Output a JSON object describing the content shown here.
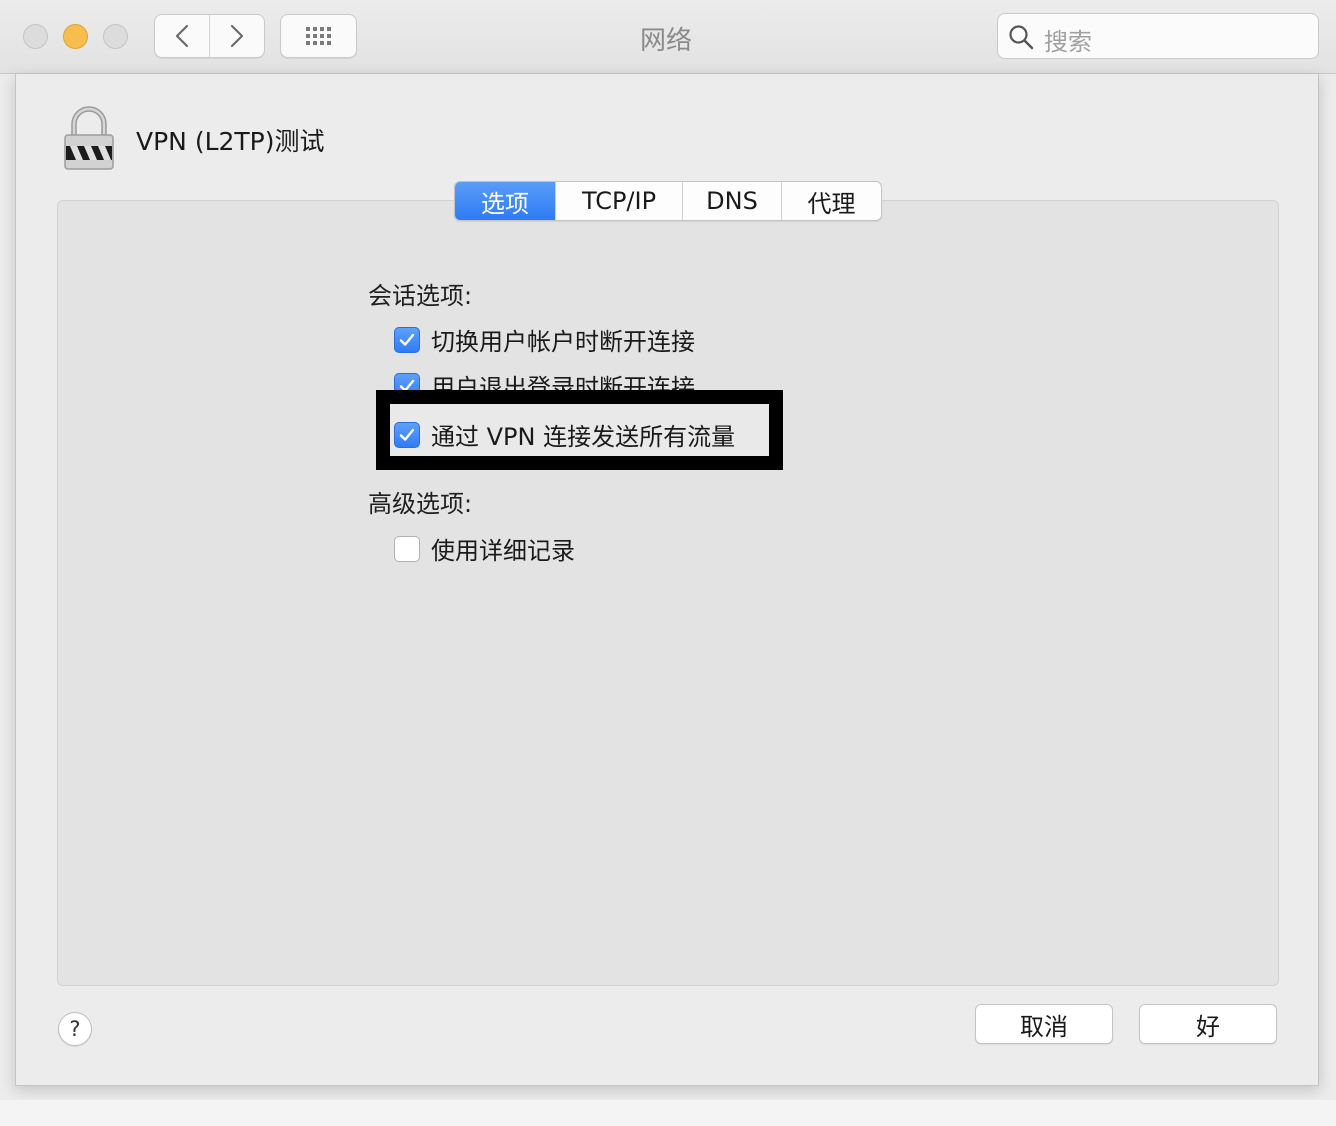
{
  "window": {
    "title": "网络"
  },
  "toolbar": {
    "back_icon": "chevron-left-icon",
    "forward_icon": "chevron-right-icon",
    "grid_icon": "grid-icon",
    "search_placeholder": "搜索"
  },
  "sheet": {
    "connection_title": "VPN (L2TP)测试",
    "tabs": [
      {
        "label": "选项",
        "active": true
      },
      {
        "label": "TCP/IP",
        "active": false
      },
      {
        "label": "DNS",
        "active": false
      },
      {
        "label": "代理",
        "active": false
      }
    ],
    "session_label": "会话选项:",
    "session_options": [
      {
        "label": "切换用户帐户时断开连接",
        "checked": true
      },
      {
        "label": "用户退出登录时断开连接",
        "checked": true
      },
      {
        "label": "通过 VPN 连接发送所有流量",
        "checked": true
      }
    ],
    "advanced_label": "高级选项:",
    "advanced_options": [
      {
        "label": "使用详细记录",
        "checked": false
      }
    ],
    "help_label": "?",
    "cancel_label": "取消",
    "ok_label": "好"
  },
  "colors": {
    "accent": "#2d7bf4",
    "highlight_border": "#000000",
    "minimize": "#f5be4f"
  }
}
